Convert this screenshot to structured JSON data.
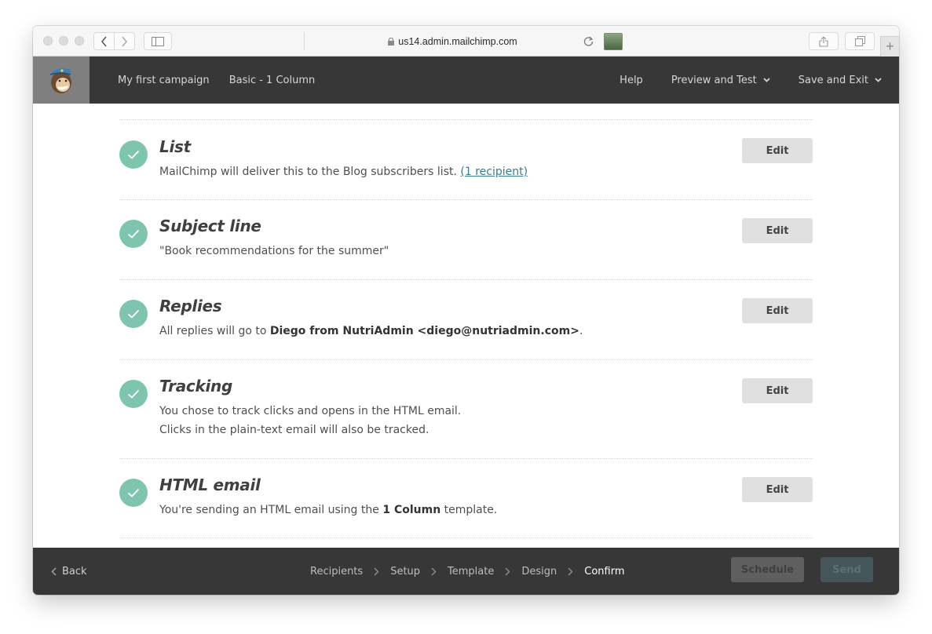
{
  "browser": {
    "url": "us14.admin.mailchimp.com",
    "new_tab_label": "+"
  },
  "header": {
    "nav_left": [
      {
        "label": "My first campaign"
      },
      {
        "label": "Basic - 1 Column"
      }
    ],
    "help_label": "Help",
    "preview_label": "Preview and Test",
    "save_label": "Save and Exit"
  },
  "sections": [
    {
      "title": "List",
      "body_prefix": "MailChimp will deliver this to the Blog subscribers list. ",
      "link": "(1 recipient)",
      "edit_label": "Edit"
    },
    {
      "title": "Subject line",
      "body": "\"Book recommendations for the summer\"",
      "edit_label": "Edit"
    },
    {
      "title": "Replies",
      "body_prefix": "All replies will go to ",
      "body_bold": "Diego from NutriAdmin <diego@nutriadmin.com>",
      "body_suffix": ".",
      "edit_label": "Edit"
    },
    {
      "title": "Tracking",
      "line1": "You chose to track clicks and opens in the HTML email.",
      "line2": "Clicks in the plain-text email will also be tracked.",
      "edit_label": "Edit"
    },
    {
      "title": "HTML email",
      "body_prefix": "You're sending an HTML email using the ",
      "body_bold": "1 Column",
      "body_suffix": " template.",
      "edit_label": "Edit"
    }
  ],
  "footer": {
    "back_label": "Back",
    "steps": [
      {
        "label": "Recipients"
      },
      {
        "label": "Setup"
      },
      {
        "label": "Template"
      },
      {
        "label": "Design"
      },
      {
        "label": "Confirm",
        "active": true
      }
    ],
    "schedule_label": "Schedule",
    "send_label": "Send"
  },
  "colors": {
    "check": "#7fc4ae",
    "header_bg": "#373737",
    "link": "#3a7d8c"
  }
}
